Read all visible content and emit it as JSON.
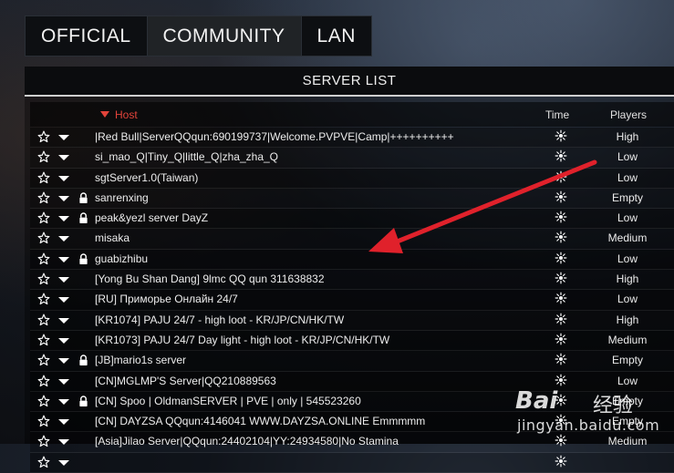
{
  "tabs": [
    {
      "label": "OFFICIAL"
    },
    {
      "label": "COMMUNITY"
    },
    {
      "label": "LAN"
    }
  ],
  "panel": {
    "title": "SERVER LIST",
    "columns": {
      "host": "Host",
      "time": "Time",
      "players": "Players"
    },
    "sort": {
      "column": "Host",
      "direction": "descending"
    }
  },
  "servers": [
    {
      "name": "|Red Bull|ServerQQqun:690199737|Welcome.PVPVE|Camp|++++++++++",
      "players": "High",
      "locked": false,
      "time_icon": "sun-icon"
    },
    {
      "name": "si_mao_Q|Tiny_Q|little_Q|zha_zha_Q",
      "players": "Low",
      "locked": false,
      "time_icon": "sun-icon"
    },
    {
      "name": "sgtServer1.0(Taiwan)",
      "players": "Low",
      "locked": false,
      "time_icon": "sun-icon"
    },
    {
      "name": "sanrenxing",
      "players": "Empty",
      "locked": true,
      "time_icon": "sun-icon"
    },
    {
      "name": "peak&yezl server DayZ",
      "players": "Low",
      "locked": true,
      "time_icon": "sun-icon"
    },
    {
      "name": "misaka",
      "players": "Medium",
      "locked": false,
      "time_icon": "sun-icon"
    },
    {
      "name": "guabizhibu",
      "players": "Low",
      "locked": true,
      "time_icon": "sun-icon"
    },
    {
      "name": "[Yong Bu Shan Dang] 9lmc QQ qun 311638832",
      "players": "High",
      "locked": false,
      "time_icon": "sun-icon"
    },
    {
      "name": "[RU] Приморье Онлайн 24/7",
      "players": "Low",
      "locked": false,
      "time_icon": "sun-icon"
    },
    {
      "name": "[KR1074] PAJU 24/7 -  high loot - KR/JP/CN/HK/TW",
      "players": "High",
      "locked": false,
      "time_icon": "sun-icon"
    },
    {
      "name": "[KR1073] PAJU 24/7 Day light - high loot - KR/JP/CN/HK/TW",
      "players": "Medium",
      "locked": false,
      "time_icon": "sun-icon"
    },
    {
      "name": "[JB]mario1s server",
      "players": "Empty",
      "locked": true,
      "time_icon": "sun-icon"
    },
    {
      "name": "[CN]MGLMP'S Server|QQ210889563",
      "players": "Low",
      "locked": false,
      "time_icon": "sun-icon"
    },
    {
      "name": "[CN] Spoo | OldmanSERVER | PVE | only | 545523260",
      "players": "Empty",
      "locked": true,
      "time_icon": "sun-icon"
    },
    {
      "name": "[CN] DAYZSA QQqun:4146041 WWW.DAYZSA.ONLINE Emmmmm",
      "players": "Empty",
      "locked": false,
      "time_icon": "sun-icon"
    },
    {
      "name": "[Asia]Jilao Server|QQqun:24402104|YY:24934580|No Stamina",
      "players": "Medium",
      "locked": false,
      "time_icon": "sun-icon"
    },
    {
      "name": "",
      "players": "",
      "locked": false,
      "time_icon": "sun-icon"
    }
  ],
  "annotation": {
    "arrow_color": "#e0212b"
  },
  "watermark": {
    "brand": "Bai",
    "brand_cn": "经验",
    "url": "jingyan.baidu.com"
  },
  "colors": {
    "accent": "#e2433a",
    "tab_active": "#202326",
    "header_bg": "#0b0c0e"
  }
}
